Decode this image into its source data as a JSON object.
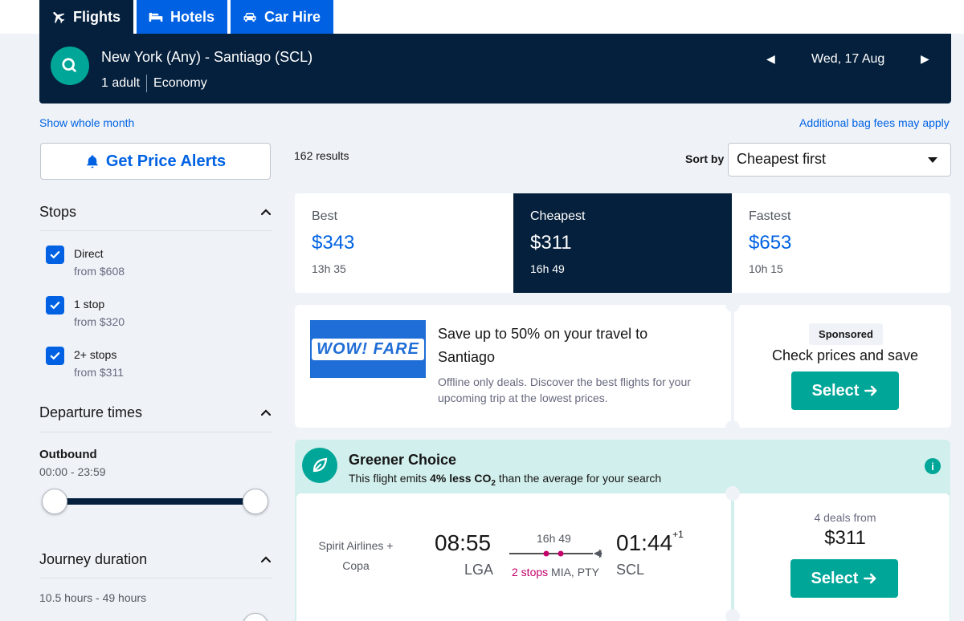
{
  "tabs": [
    {
      "label": "Flights",
      "icon": "plane-icon",
      "active": true
    },
    {
      "label": "Hotels",
      "icon": "bed-icon",
      "active": false
    },
    {
      "label": "Car Hire",
      "icon": "car-icon",
      "active": false
    }
  ],
  "search": {
    "route": "New York (Any) - Santiago (SCL)",
    "adults": "1 adult",
    "cabin": "Economy",
    "date": "Wed, 17 Aug",
    "prev_symbol": "◀",
    "next_symbol": "▶"
  },
  "links": {
    "show_month": "Show whole month",
    "bag_fees": "Additional bag fees may apply"
  },
  "price_alerts": "Get Price Alerts",
  "filters": {
    "stops_title": "Stops",
    "stops": [
      {
        "label": "Direct",
        "price": "from $608",
        "checked": true
      },
      {
        "label": "1 stop",
        "price": "from $320",
        "checked": true
      },
      {
        "label": "2+ stops",
        "price": "from $311",
        "checked": true
      }
    ],
    "departure_title": "Departure times",
    "outbound_title": "Outbound",
    "outbound_range": "00:00 - 23:59",
    "journey_title": "Journey duration",
    "journey_range": "10.5 hours - 49 hours"
  },
  "results": {
    "count": "162 results",
    "sort_label": "Sort by",
    "sort_value": "Cheapest first"
  },
  "sort_tabs": [
    {
      "name": "Best",
      "price": "$343",
      "duration": "13h 35",
      "active": false
    },
    {
      "name": "Cheapest",
      "price": "$311",
      "duration": "16h 49",
      "active": true
    },
    {
      "name": "Fastest",
      "price": "$653",
      "duration": "10h 15",
      "active": false
    }
  ],
  "ad": {
    "logo_text": "WOW! FARE",
    "title": "Save up to 50% on your travel to Santiago",
    "subtitle": "Offline only deals. Discover the best flights for your upcoming trip at the lowest prices.",
    "sponsored": "Sponsored",
    "cta_text": "Check prices and save",
    "select": "Select"
  },
  "greener": {
    "title": "Greener Choice",
    "sub_pre": "This flight emits ",
    "sub_bold": "4% less CO",
    "sub_subscript": "2",
    "sub_post": " than the average for your search"
  },
  "flight": {
    "airline": "Spirit Airlines + Copa",
    "depart_time": "08:55",
    "depart_airport": "LGA",
    "duration": "16h 49",
    "stops": "2 stops",
    "stop_airports": "MIA, PTY",
    "arrive_time": "01:44",
    "arrive_offset": "+1",
    "arrive_airport": "SCL",
    "deals": "4 deals from",
    "price": "$311",
    "select": "Select"
  },
  "colors": {
    "navy": "#05203c",
    "blue": "#0062e3",
    "teal": "#00a698",
    "stops_red": "#c4006a"
  }
}
